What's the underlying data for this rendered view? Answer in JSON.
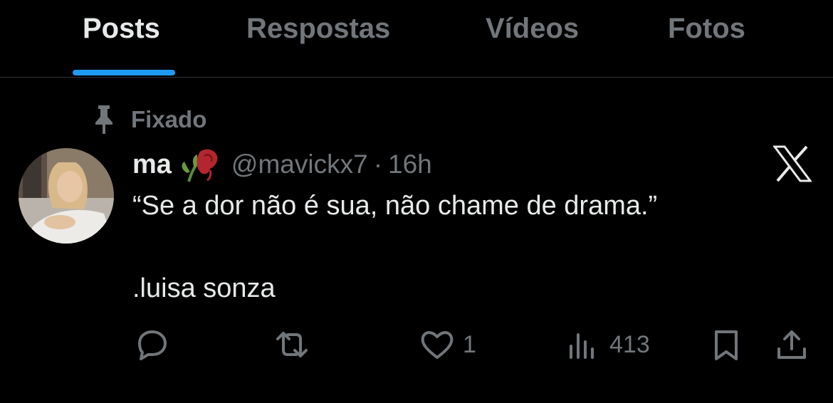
{
  "tabs": [
    {
      "label": "Posts",
      "active": true
    },
    {
      "label": "Respostas",
      "active": false
    },
    {
      "label": "Vídeos",
      "active": false
    },
    {
      "label": "Fotos",
      "active": false
    }
  ],
  "pinned_label": "Fixado",
  "post": {
    "name": "ma",
    "handle": "@mavickx7",
    "separator": "·",
    "time": "16h",
    "text_lines": [
      "“Se a dor não é sua, não chame de drama.”",
      ".luisa sonza"
    ],
    "likes": "1",
    "views": "413"
  },
  "icons": {
    "pin": "pin-icon",
    "name_emoji": "wilted-rose-icon",
    "logo": "x-logo-icon",
    "reply": "reply-icon",
    "repost": "repost-icon",
    "like": "heart-icon",
    "views": "views-icon",
    "bookmark": "bookmark-icon",
    "share": "share-icon"
  },
  "colors": {
    "background": "#000000",
    "text": "#e7e9ea",
    "muted": "#71767b",
    "accent": "#1d9bf0",
    "divider": "#2f3336"
  }
}
